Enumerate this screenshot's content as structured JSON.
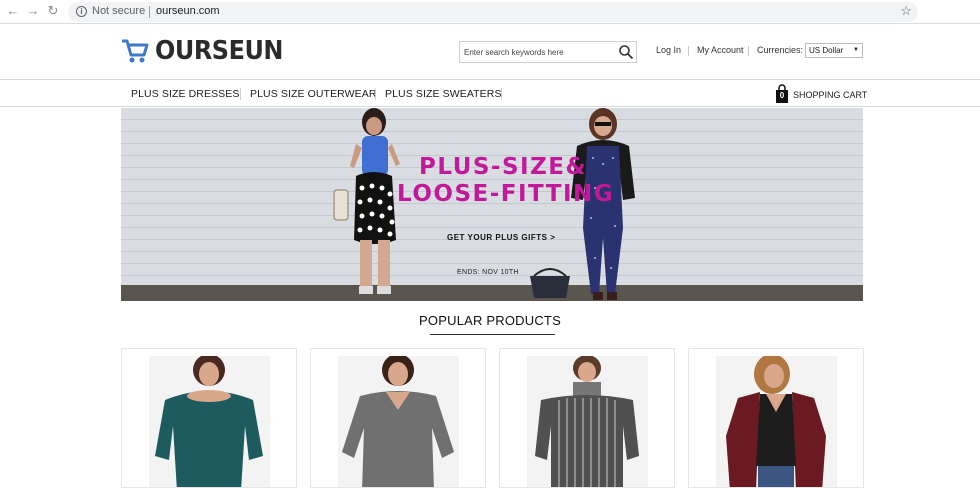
{
  "browser": {
    "security_label": "Not secure",
    "url": "ourseun.com",
    "icons": [
      "back-arrow-icon",
      "forward-arrow-icon",
      "reload-icon",
      "info-icon",
      "star-icon"
    ]
  },
  "header": {
    "logo_text": "OURSEUN",
    "search_placeholder": "Enter search keywords here",
    "login_label": "Log In",
    "account_label": "My Account",
    "currencies_label": "Currencies:",
    "currency_value": "US Dollar"
  },
  "nav": {
    "categories": [
      {
        "label": "PLUS SIZE DRESSES"
      },
      {
        "label": "PLUS SIZE OUTERWEAR"
      },
      {
        "label": "PLUS SIZE SWEATERS"
      }
    ],
    "cart_count": "0",
    "cart_label": "SHOPPING CART"
  },
  "hero": {
    "title_line1": "PLUS-SIZE&",
    "title_line2": "LOOSE-FITTING",
    "cta": "GET YOUR PLUS GIFTS >",
    "ends": "ENDS: NOV 10TH"
  },
  "popular": {
    "title": "POPULAR PRODUCTS",
    "products": [
      {
        "color": "#1e5b5f"
      },
      {
        "color": "#707070"
      },
      {
        "color": "#505050"
      },
      {
        "color": "#6b1a22"
      }
    ]
  },
  "colors": {
    "hero_accent": "#c2189a",
    "logo_icon": "#3f7ac8"
  }
}
